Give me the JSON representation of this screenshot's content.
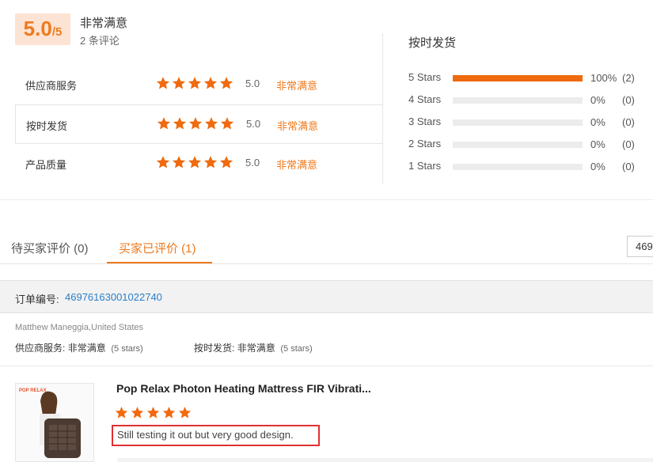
{
  "summary": {
    "score": "5.0",
    "score_suffix": "/5",
    "overall_text": "非常满意",
    "review_count": "2 条评论"
  },
  "ratings": [
    {
      "label": "供应商服务",
      "value": "5.0",
      "text": "非常满意"
    },
    {
      "label": "按时发货",
      "value": "5.0",
      "text": "非常满意"
    },
    {
      "label": "产品质量",
      "value": "5.0",
      "text": "非常满意"
    }
  ],
  "distribution": {
    "title": "按时发货",
    "rows": [
      {
        "label": "5  Stars",
        "percent_value": 1.0,
        "percent": "100%",
        "count": "(2)"
      },
      {
        "label": "4  Stars",
        "percent_value": 0.0,
        "percent": "0%",
        "count": "(0)"
      },
      {
        "label": "3  Stars",
        "percent_value": 0.0,
        "percent": "0%",
        "count": "(0)"
      },
      {
        "label": "2  Stars",
        "percent_value": 0.0,
        "percent": "0%",
        "count": "(0)"
      },
      {
        "label": "1  Stars",
        "percent_value": 0.0,
        "percent": "0%",
        "count": "(0)"
      }
    ]
  },
  "tabs": {
    "pending": "待买家评价 (0)",
    "reviewed": "买家已评价 (1)"
  },
  "search": {
    "value": "469"
  },
  "order": {
    "label": "订单编号:",
    "number": "46976163001022740"
  },
  "buyer": {
    "name": "Matthew Maneggia,United States",
    "service_label": "供应商服务:",
    "service_text": "非常满意",
    "service_stars": "(5 stars)",
    "delivery_label": "按时发货:",
    "delivery_text": "非常满意",
    "delivery_stars": "(5 stars)"
  },
  "product": {
    "title": "Pop Relax Photon Heating Mattress FIR Vibrati...",
    "comment": "Still testing it out but very good design.",
    "brand_logo": "POP RELAX",
    "rating": 5
  },
  "colors": {
    "accent": "#ee7a1e",
    "star": "#f06a0f",
    "link": "#2a7fc9",
    "highlight_border": "#e03030"
  }
}
